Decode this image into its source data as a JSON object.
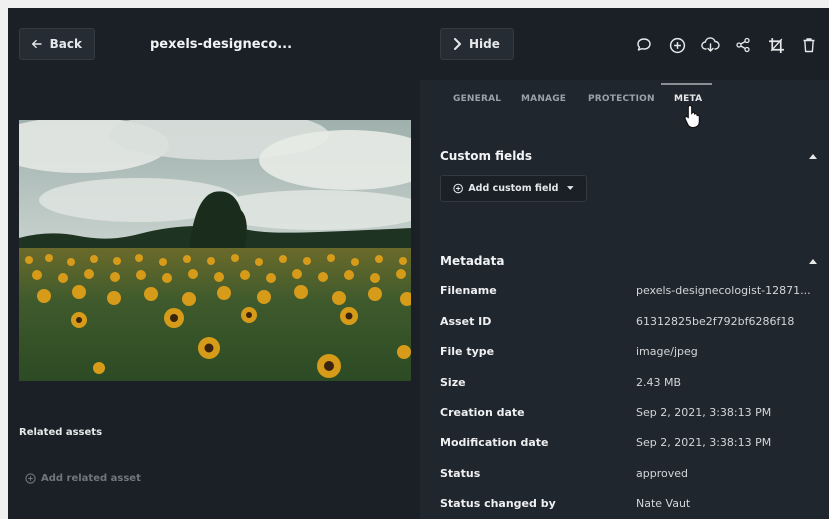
{
  "left": {
    "back_label": "Back",
    "file_title": "pexels-designeco...",
    "related_assets_label": "Related assets",
    "add_related_label": "Add related asset"
  },
  "right": {
    "hide_label": "Hide",
    "toolbar_icons": [
      "comment-icon",
      "add-circle-icon",
      "cloud-download-icon",
      "share-icon",
      "crop-icon",
      "trash-icon"
    ],
    "tabs": [
      {
        "label": "GENERAL",
        "active": false
      },
      {
        "label": "MANAGE",
        "active": false
      },
      {
        "label": "PROTECTION",
        "active": false
      },
      {
        "label": "META",
        "active": true
      }
    ],
    "custom_fields": {
      "title": "Custom fields",
      "add_label": "Add custom field"
    },
    "metadata": {
      "title": "Metadata",
      "rows": [
        {
          "key": "Filename",
          "value": "pexels-designecologist-12871..."
        },
        {
          "key": "Asset ID",
          "value": "61312825be2f792bf6286f18"
        },
        {
          "key": "File type",
          "value": "image/jpeg"
        },
        {
          "key": "Size",
          "value": "2.43 MB"
        },
        {
          "key": "Creation date",
          "value": "Sep 2, 2021, 3:38:13 PM"
        },
        {
          "key": "Modification date",
          "value": "Sep 2, 2021, 3:38:13 PM"
        },
        {
          "key": "Status",
          "value": "approved"
        },
        {
          "key": "Status changed by",
          "value": "Nate Vaut"
        }
      ]
    }
  },
  "colors": {
    "panel_dark": "#1b2026",
    "panel_right": "#20262d",
    "text": "#e6e8ea",
    "muted": "#6f767e"
  }
}
